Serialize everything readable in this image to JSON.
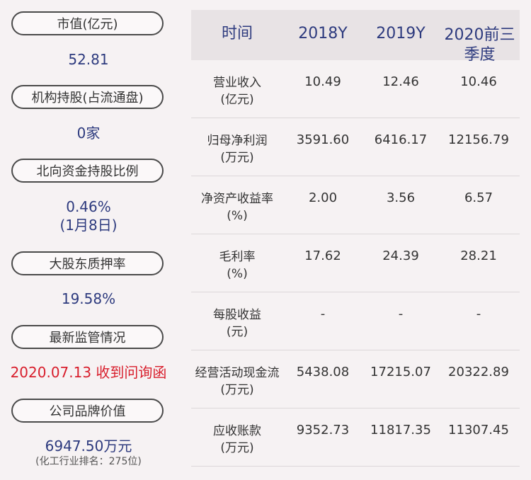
{
  "left_panel": [
    {
      "label": "市值(亿元)",
      "value": "52.81"
    },
    {
      "label": "机构持股(占流通盘)",
      "value": "0家"
    },
    {
      "label": "北向资金持股比例",
      "value": "0.46%",
      "value2": "(1月8日)"
    },
    {
      "label": "大股东质押率",
      "value": "19.58%"
    },
    {
      "label": "最新监管情况",
      "value": "2020.07.13 收到问询函"
    },
    {
      "label": "公司品牌价值",
      "value": "6947.50万元",
      "note": "(化工行业排名：275位)"
    }
  ],
  "table": {
    "headers": [
      "时间",
      "2018Y",
      "2019Y",
      "2020前三季度"
    ],
    "rows": [
      {
        "label": "营业收入",
        "unit": "(亿元)",
        "values": [
          "10.49",
          "12.46",
          "10.46"
        ]
      },
      {
        "label": "归母净利润",
        "unit": "(万元)",
        "values": [
          "3591.60",
          "6416.17",
          "12156.79"
        ]
      },
      {
        "label": "净资产收益率",
        "unit": "(%)",
        "values": [
          "2.00",
          "3.56",
          "6.57"
        ]
      },
      {
        "label": "毛利率",
        "unit": "(%)",
        "values": [
          "17.62",
          "24.39",
          "28.21"
        ]
      },
      {
        "label": "每股收益",
        "unit": "(元)",
        "values": [
          "-",
          "-",
          "-"
        ]
      },
      {
        "label": "经营活动现金流",
        "unit": "(万元)",
        "values": [
          "5438.08",
          "17215.07",
          "20322.89"
        ]
      },
      {
        "label": "应收账款",
        "unit": "(万元)",
        "values": [
          "9352.73",
          "11817.35",
          "11307.45"
        ]
      }
    ]
  },
  "colors": {
    "accent": "#2d3a7e",
    "alert": "#d81e2c",
    "background": "#f6f2f3"
  }
}
